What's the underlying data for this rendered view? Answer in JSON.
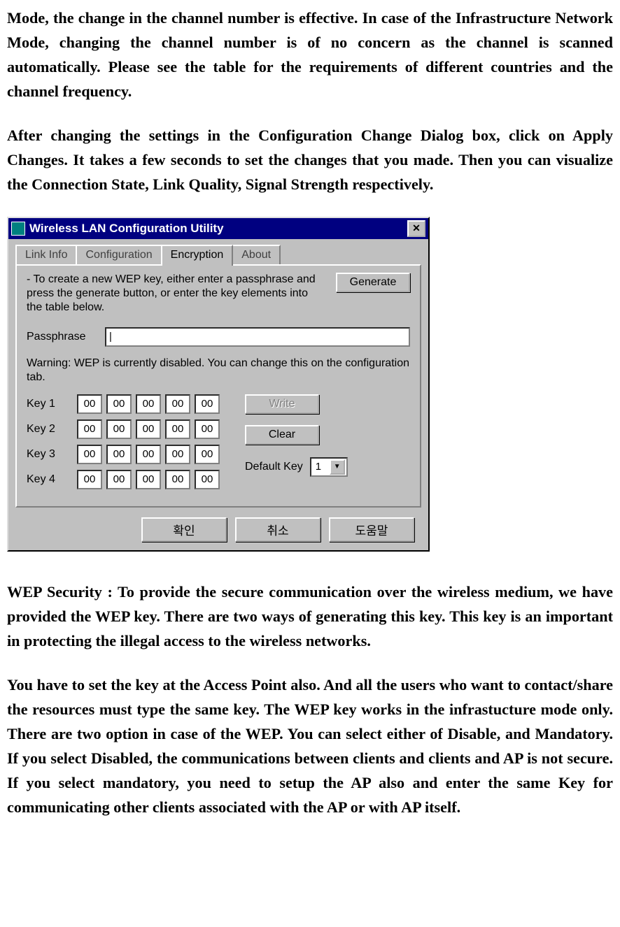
{
  "para1": "Mode, the change in the channel number is effective. In case of the Infrastructure Network Mode, changing the channel number is of no concern as the channel is scanned automatically. Please see the table for the requirements of different countries and the channel frequency.",
  "para2": "After changing the settings in the Configuration Change Dialog box, click on Apply Changes. It takes a few seconds to set the changes that you made. Then you can visualize the Connection State, Link Quality, Signal Strength respectively.",
  "para3": "WEP Security : To provide the secure communication over the wireless medium, we have provided the WEP key. There are two ways of generating this key. This key is an important in protecting the illegal access to the wireless networks.",
  "para4": "You have to set the key at the Access Point also. And all the users who want to contact/share the resources must type the same key.  The WEP key works in the infrastucture mode only. There are two option in case of the WEP. You can select either of Disable, and Mandatory. If you select Disabled, the communications between clients and clients and AP is not secure. If you select mandatory, you need to setup the AP also and enter the same Key for communicating other clients associated with the AP or with AP itself.",
  "dialog": {
    "title": "Wireless LAN Configuration Utility",
    "close_x": "✕",
    "tabs": {
      "t0": "Link Info",
      "t1": "Configuration",
      "t2": "Encryption",
      "t3": "About"
    },
    "instr": "- To create a new WEP key, either enter a passphrase and press the generate button, or enter the key elements into the table below.",
    "generate": "Generate",
    "pass_label": "Passphrase",
    "pass_value": "|",
    "warn": "Warning: WEP is currently disabled.  You can change this on the configuration tab.",
    "keys": {
      "k1": "Key 1",
      "k2": "Key 2",
      "k3": "Key 3",
      "k4": "Key 4",
      "oct": "00"
    },
    "write": "Write",
    "clear": "Clear",
    "def_label": "Default Key",
    "def_value": "1",
    "ok": "확인",
    "cancel": "취소",
    "help": "도움말"
  }
}
